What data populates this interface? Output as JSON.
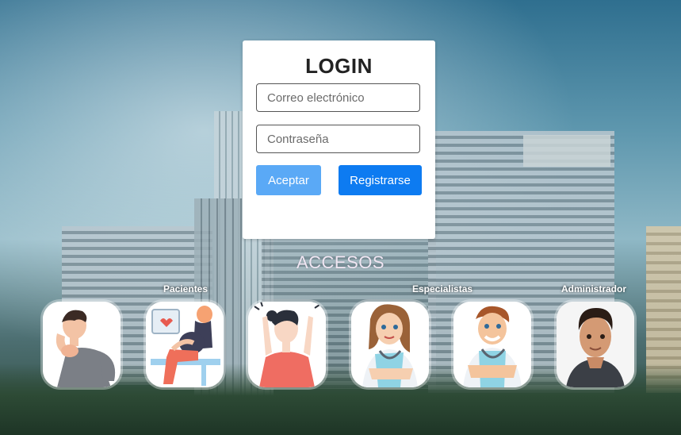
{
  "login": {
    "title": "LOGIN",
    "email_placeholder": "Correo electrónico",
    "password_placeholder": "Contraseña",
    "accept_label": "Aceptar",
    "register_label": "Registrarse"
  },
  "access": {
    "title": "ACCESOS",
    "groups": [
      "Pacientes",
      "Especialistas",
      "Administrador"
    ],
    "tiles": [
      {
        "icon": "sick-patient-icon"
      },
      {
        "icon": "pregnant-patient-icon"
      },
      {
        "icon": "stressed-patient-icon"
      },
      {
        "icon": "nurse-icon"
      },
      {
        "icon": "male-nurse-icon"
      },
      {
        "icon": "admin-avatar-icon"
      }
    ]
  },
  "colors": {
    "accept_button": "#5aa9f6",
    "register_button": "#0d7bf1"
  }
}
